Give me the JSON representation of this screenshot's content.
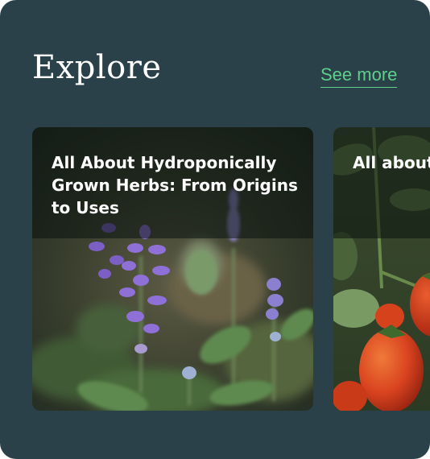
{
  "section": {
    "title": "Explore",
    "see_more_label": "See more"
  },
  "cards": [
    {
      "title": "All About Hydroponically Grown Herbs: From Origins to Uses",
      "image": "lavender-salvia-flowers-photo"
    },
    {
      "title": "All about Touchstone",
      "image": "tomato-plant-photo"
    }
  ],
  "colors": {
    "background": "#2a4149",
    "link": "#5fd08b",
    "card_title": "#ffffff"
  }
}
